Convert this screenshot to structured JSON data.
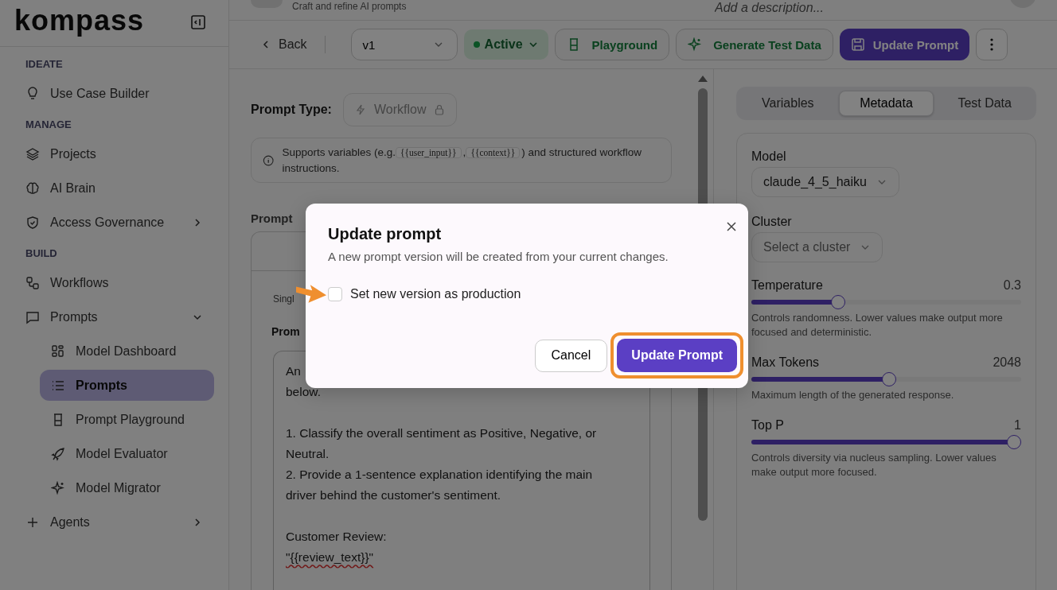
{
  "sidebar": {
    "logo": "kompass",
    "sections": [
      {
        "heading": "IDEATE",
        "items": [
          {
            "label": "Use Case Builder",
            "selected": false
          }
        ]
      },
      {
        "heading": "MANAGE",
        "items": [
          {
            "label": "Projects",
            "selected": false
          },
          {
            "label": "AI Brain",
            "selected": false
          },
          {
            "label": "Access Governance",
            "selected": false,
            "expanded": false
          }
        ]
      },
      {
        "heading": "BUILD",
        "items": [
          {
            "label": "Workflows",
            "selected": false
          },
          {
            "label": "Prompts",
            "selected": false,
            "expanded": true,
            "children": [
              {
                "label": "Model Dashboard",
                "selected": false
              },
              {
                "label": "Prompts",
                "selected": true
              },
              {
                "label": "Prompt Playground",
                "selected": false
              },
              {
                "label": "Model Evaluator",
                "selected": false
              },
              {
                "label": "Model Migrator",
                "selected": false
              }
            ]
          },
          {
            "label": "Agents",
            "selected": false,
            "expanded": false
          }
        ]
      }
    ]
  },
  "header": {
    "subtitle": "Craft and refine AI prompts",
    "description_placeholder": "Add a description..."
  },
  "toolbar": {
    "back": "Back",
    "version": "v1",
    "status": "Active",
    "buttons": [
      {
        "label": "Playground",
        "kind": "outline"
      },
      {
        "label": "Generate Test Data",
        "kind": "outline"
      },
      {
        "label": "Update Prompt",
        "kind": "primary"
      }
    ]
  },
  "editor": {
    "prompt_type_label": "Prompt Type:",
    "prompt_type": "Workflow",
    "locked": true,
    "note": [
      {
        "kind": "text",
        "text": "Supports variables (e.g."
      },
      {
        "kind": "code",
        "text": "{{user_input}}"
      },
      {
        "kind": "text",
        "text": ","
      },
      {
        "kind": "code",
        "text": "{{context}}"
      },
      {
        "kind": "text",
        "text": ") and structured workflow instructions."
      }
    ],
    "section_label": "Prompt",
    "mode_label": "Singl",
    "field_label": "Prom",
    "paragraphs": [
      [
        "An",
        "below."
      ],
      [
        "1. Classify the overall sentiment as Positive, Negative, or",
        "Neutral.",
        "2. Provide a 1-sentence explanation identifying the main",
        "driver behind the customer's sentiment."
      ],
      [
        "Customer Review:",
        "\"{{review_text}}\""
      ]
    ]
  },
  "side_panel": {
    "tabs": [
      {
        "label": "Variables",
        "selected": false
      },
      {
        "label": "Metadata",
        "selected": true
      },
      {
        "label": "Test Data",
        "selected": false
      }
    ],
    "model_label": "Model",
    "model": "claude_4_5_haiku",
    "cluster_label": "Cluster",
    "cluster_placeholder": "Select a cluster",
    "sliders": [
      {
        "label": "Temperature",
        "reading": "0.3",
        "level": 0.31,
        "hint": "Controls randomness. Lower values make output more focused and deterministic."
      },
      {
        "label": "Max Tokens",
        "reading": "2048",
        "level": 0.51,
        "hint": "Maximum length of the generated response."
      },
      {
        "label": "Top P",
        "reading": "1",
        "level": 1,
        "hint": "Controls diversity via nucleus sampling. Lower values make output more focused."
      }
    ]
  },
  "modal": {
    "title": "Update prompt",
    "description": "A new prompt version will be created from your current changes.",
    "checkbox": {
      "label": "Set new version as production",
      "checked": false
    },
    "cancel": "Cancel",
    "confirm": "Update Prompt",
    "confirm_highlighted": true
  }
}
